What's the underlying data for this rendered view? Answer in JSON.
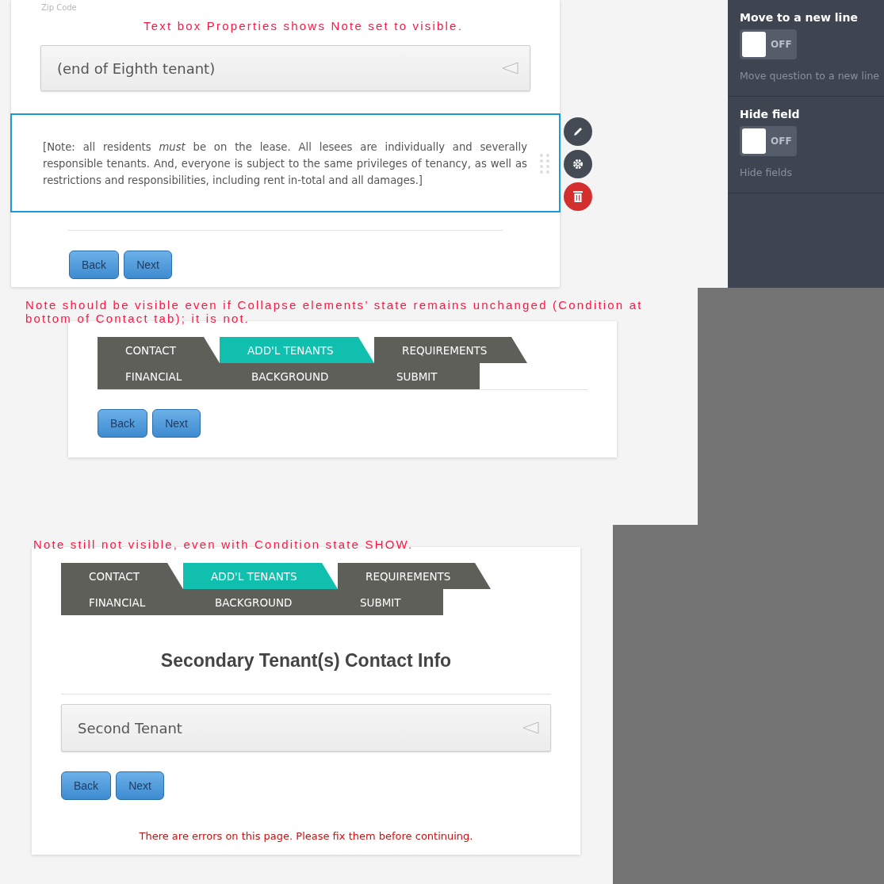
{
  "editor_view": {
    "annotation": "Text box Properties shows Note set to visible.",
    "field_label": "Zip Code",
    "collapse": {
      "title": "(end of Eighth tenant)"
    },
    "note": {
      "text": "[Note: all residents *must* be on the lease. All lesees are individually and severally responsible tenants. And, everyone is subject to the same privileges of tenancy, as well as restrictions and responsibilities, including rent in-total and all damages.]",
      "selected": true
    },
    "buttons": [
      "Back",
      "Next"
    ],
    "properties": [
      {
        "title": "Move to a new line",
        "toggle": {
          "on": false,
          "label": "OFF"
        },
        "hint": "Move question to a new line"
      },
      {
        "title": "Hide field",
        "toggle": {
          "on": false,
          "label": "OFF"
        },
        "hint": "Hide fields"
      }
    ]
  },
  "preview_1": {
    "annotation": "Note should be visible even if Collapse elements’ state remains unchanged (Condition at bottom of Contact tab); it is not.",
    "tabs": [
      [
        {
          "label": "CONTACT",
          "selected": false
        },
        {
          "label": "ADD'L TENANTS",
          "selected": true
        },
        {
          "label": "REQUIREMENTS",
          "selected": false
        }
      ],
      [
        {
          "label": "FINANCIAL",
          "selected": false
        },
        {
          "label": "BACKGROUND",
          "selected": false
        },
        {
          "label": "SUBMIT",
          "selected": false
        }
      ]
    ],
    "buttons": [
      "Back",
      "Next"
    ]
  },
  "preview_2": {
    "annotation": "Note still not visible, even with Condition state SHOW.",
    "tabs": [
      [
        {
          "label": "CONTACT",
          "selected": false
        },
        {
          "label": "ADD'L TENANTS",
          "selected": true
        },
        {
          "label": "REQUIREMENTS",
          "selected": false
        }
      ],
      [
        {
          "label": "FINANCIAL",
          "selected": false
        },
        {
          "label": "BACKGROUND",
          "selected": false
        },
        {
          "label": "SUBMIT",
          "selected": false
        }
      ]
    ],
    "heading": "Secondary Tenant(s) Contact Info",
    "collapse": {
      "title": "Second Tenant"
    },
    "buttons": [
      "Back",
      "Next"
    ],
    "error": "There are errors on this page. Please fix them before continuing."
  }
}
